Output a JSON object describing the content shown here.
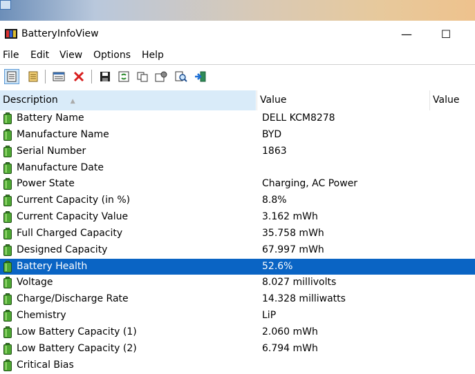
{
  "window": {
    "title": "BatteryInfoView",
    "minimize_glyph": "—",
    "maximize_glyph": "☐"
  },
  "menu": [
    "File",
    "Edit",
    "View",
    "Options",
    "Help"
  ],
  "toolbar_icons": [
    "html-report-icon",
    "text-report-icon",
    "properties-list-icon",
    "delete-icon",
    "save-icon",
    "refresh-icon",
    "copy-icon",
    "properties-icon",
    "find-icon",
    "exit-icon"
  ],
  "columns": {
    "description": "Description",
    "value": "Value",
    "value2": "Value"
  },
  "rows": [
    {
      "label": "Battery Name",
      "value": "DELL KCM8278"
    },
    {
      "label": "Manufacture Name",
      "value": "BYD"
    },
    {
      "label": "Serial Number",
      "value": "1863"
    },
    {
      "label": "Manufacture Date",
      "value": ""
    },
    {
      "label": "Power State",
      "value": "Charging, AC Power"
    },
    {
      "label": "Current Capacity (in %)",
      "value": "8.8%"
    },
    {
      "label": "Current Capacity Value",
      "value": "3.162 mWh"
    },
    {
      "label": "Full Charged Capacity",
      "value": "35.758 mWh"
    },
    {
      "label": "Designed Capacity",
      "value": "67.997 mWh"
    },
    {
      "label": "Battery Health",
      "value": "52.6%"
    },
    {
      "label": "Voltage",
      "value": "8.027 millivolts"
    },
    {
      "label": "Charge/Discharge Rate",
      "value": "14.328 milliwatts"
    },
    {
      "label": "Chemistry",
      "value": "LiP"
    },
    {
      "label": "Low Battery Capacity (1)",
      "value": "2.060 mWh"
    },
    {
      "label": "Low Battery Capacity (2)",
      "value": "6.794 mWh"
    },
    {
      "label": "Critical Bias",
      "value": ""
    }
  ],
  "selected_row": "Battery Health",
  "colors": {
    "selection": "#0a64c4",
    "header_sorted": "#d9ebf9",
    "battery_icon": "#3f8f2a"
  }
}
